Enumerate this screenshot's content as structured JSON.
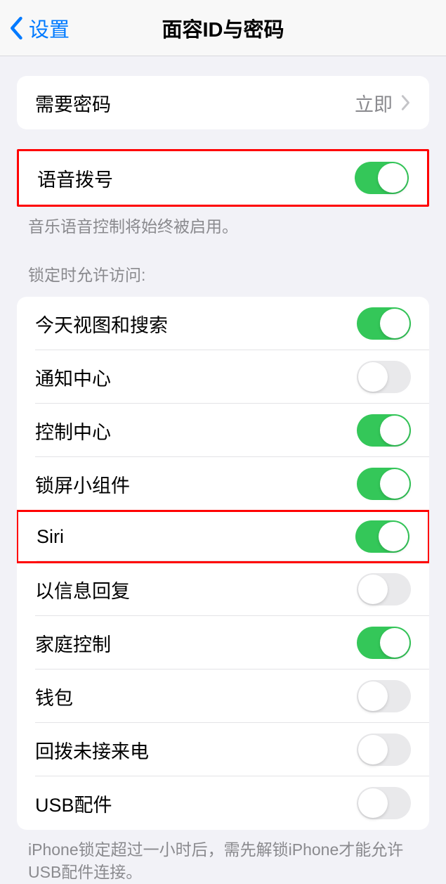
{
  "nav": {
    "back_label": "设置",
    "title": "面容ID与密码"
  },
  "require_passcode": {
    "label": "需要密码",
    "value": "立即"
  },
  "voice_dial": {
    "label": "语音拨号",
    "footer": "音乐语音控制将始终被启用。",
    "enabled": true
  },
  "locked_access": {
    "header": "锁定时允许访问:",
    "items": [
      {
        "label": "今天视图和搜索",
        "enabled": true,
        "highlight": false
      },
      {
        "label": "通知中心",
        "enabled": false,
        "highlight": false
      },
      {
        "label": "控制中心",
        "enabled": true,
        "highlight": false
      },
      {
        "label": "锁屏小组件",
        "enabled": true,
        "highlight": false
      },
      {
        "label": "Siri",
        "enabled": true,
        "highlight": true
      },
      {
        "label": "以信息回复",
        "enabled": false,
        "highlight": false
      },
      {
        "label": "家庭控制",
        "enabled": true,
        "highlight": false
      },
      {
        "label": "钱包",
        "enabled": false,
        "highlight": false
      },
      {
        "label": "回拨未接来电",
        "enabled": false,
        "highlight": false
      },
      {
        "label": "USB配件",
        "enabled": false,
        "highlight": false
      }
    ],
    "footer": "iPhone锁定超过一小时后，需先解锁iPhone才能允许USB配件连接。"
  }
}
